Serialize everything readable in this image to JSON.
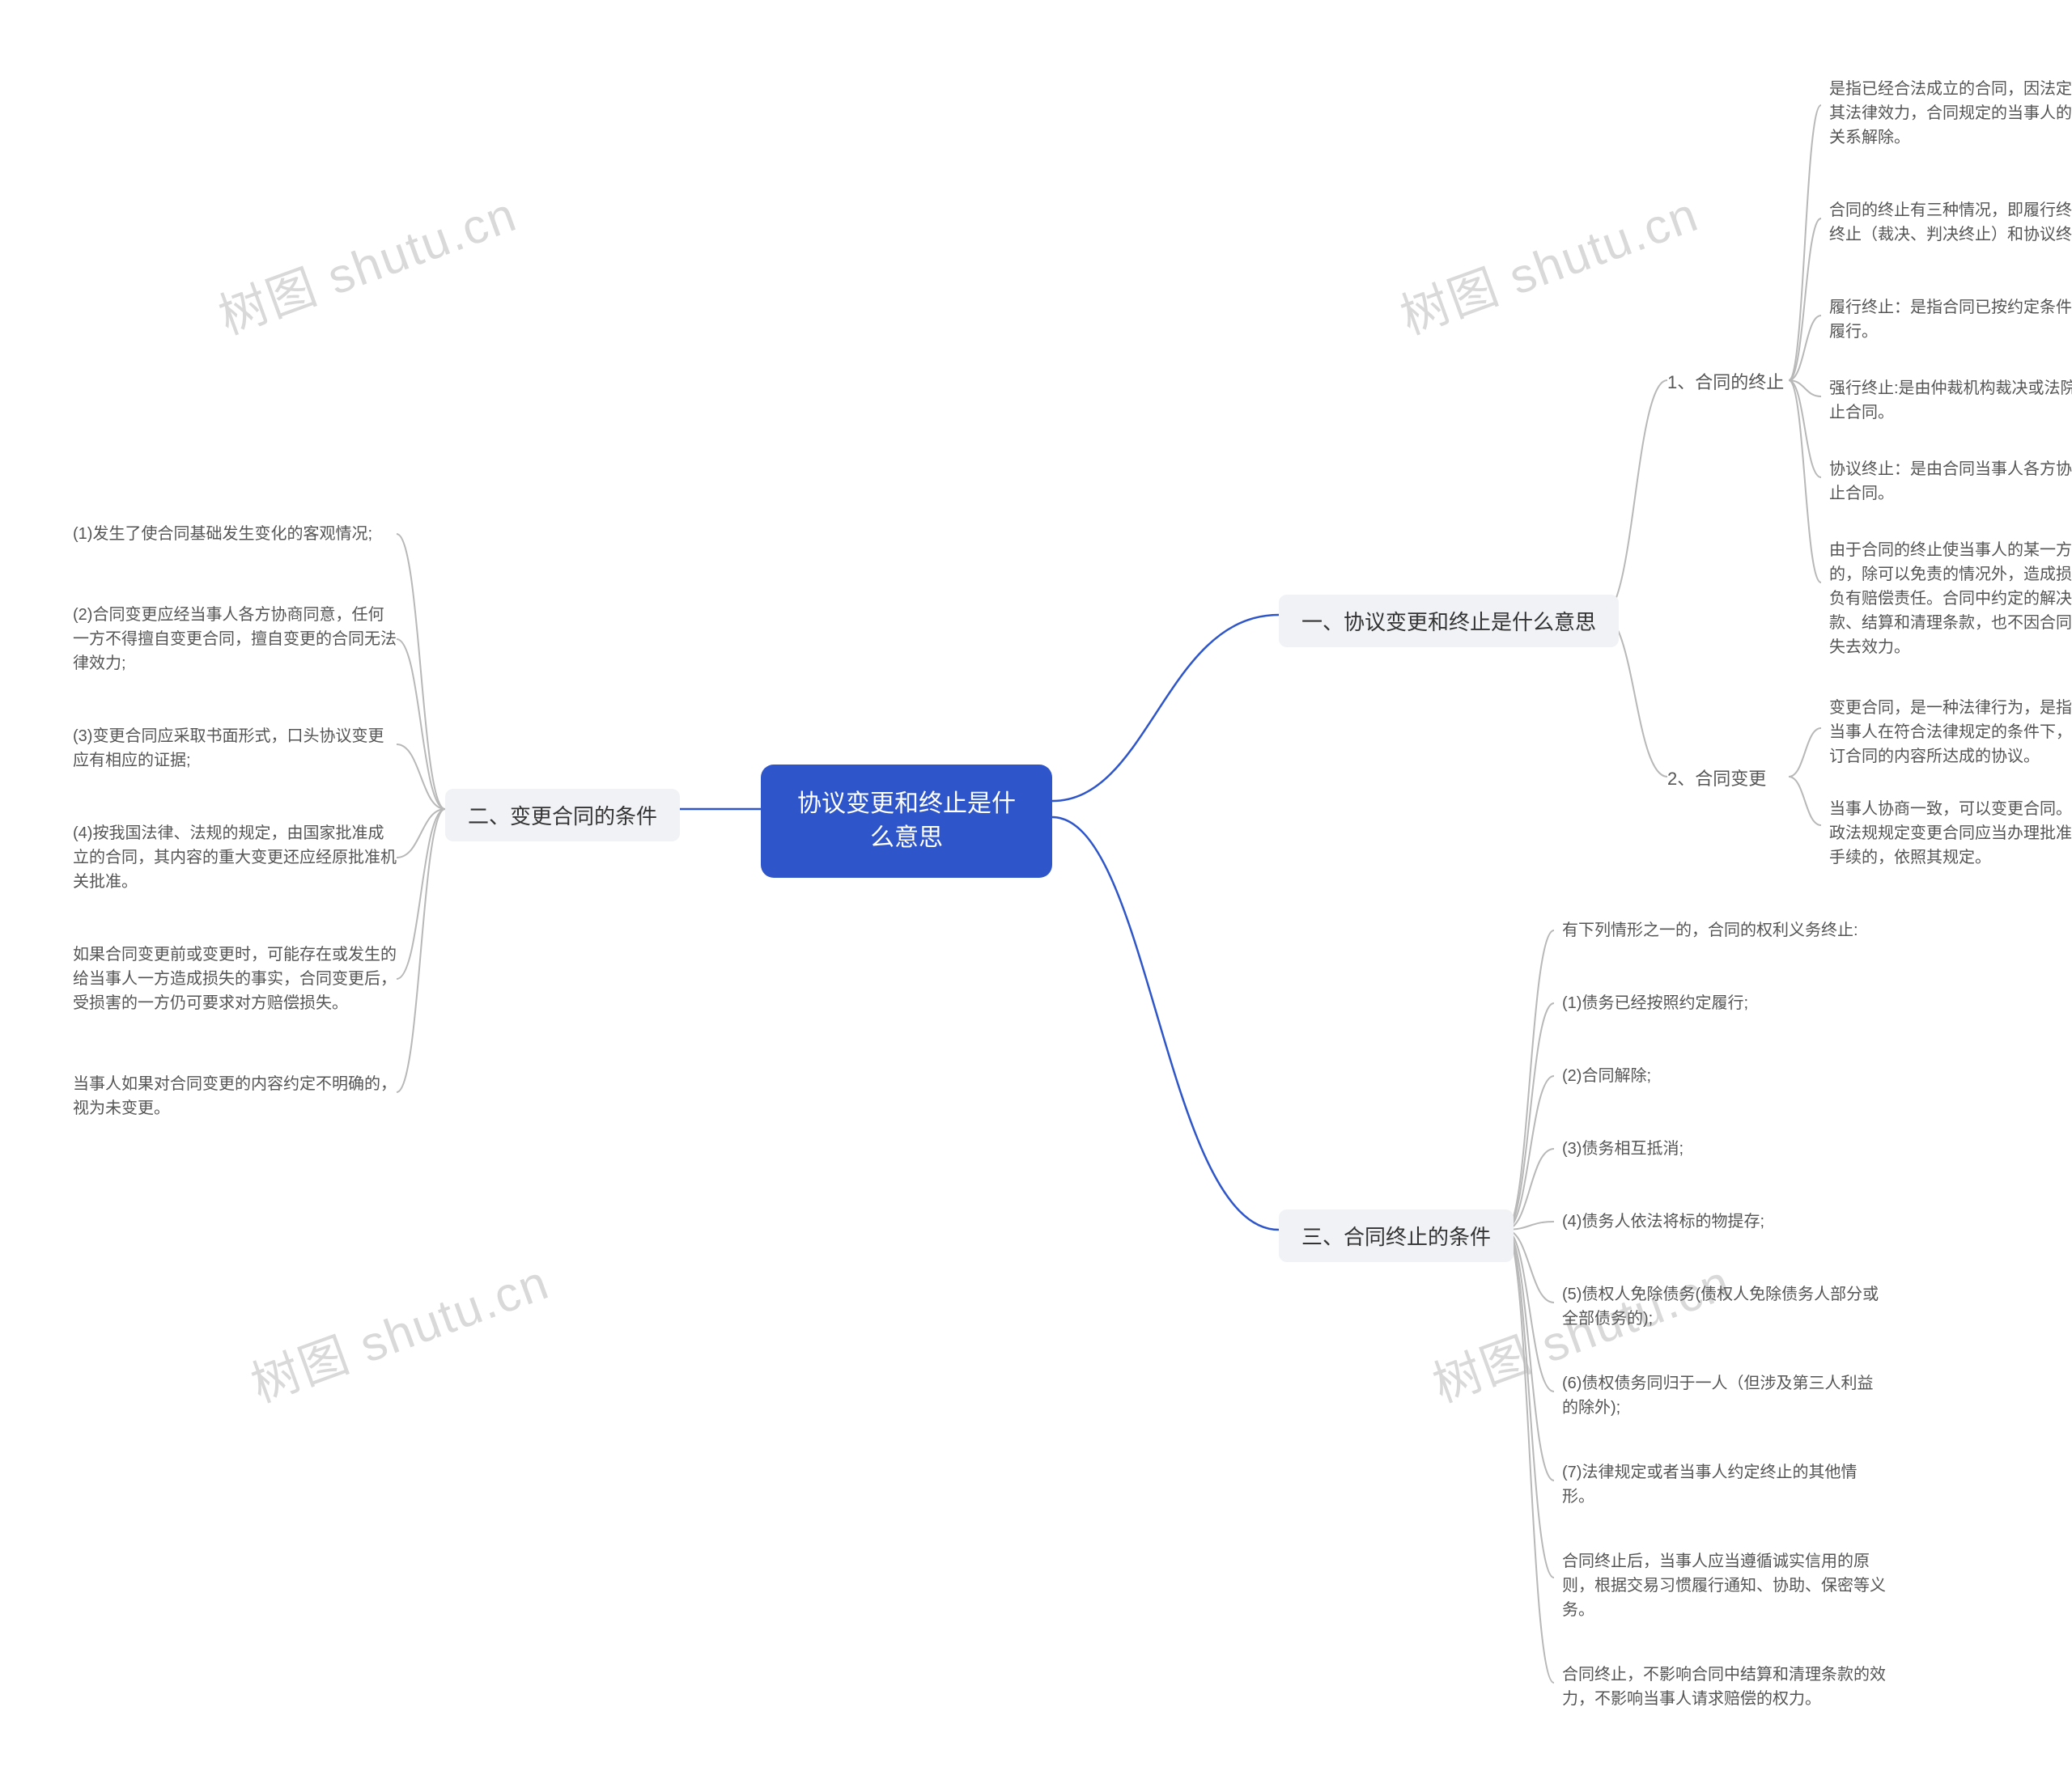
{
  "watermark": "树图 shutu.cn",
  "root": "协议变更和终止是什么意思",
  "b1": {
    "title": "一、协议变更和终止是什么意思",
    "s1": {
      "title": "1、合同的终止",
      "leaves": [
        "是指已经合法成立的合同，因法定原因终止其法律效力，合同规定的当事人的权利义务关系解除。",
        "合同的终止有三种情况，即履行终止、强行终止（裁决、判决终止）和协议终止。",
        "履行终止：是指合同已按约定条件得到全面履行。",
        "强行终止:是由仲裁机构裁决或法院判决终止合同。",
        "协议终止：是由合同当事人各方协商同意终止合同。",
        "由于合同的终止使当事人的某一方遭受损失的，除可以免责的情况外，造成损失的一方负有赔偿责任。合同中约定的解决争议的条款、结算和清理条款，也不因合同的终止而失去效力。"
      ]
    },
    "s2": {
      "title": "2、合同变更",
      "leaves": [
        "变更合同，是一种法律行为，是指签约双方当事人在符合法律规定的条件下，就修改原订合同的内容所达成的协议。",
        "当事人协商一致，可以变更合同。法律、行政法规规定变更合同应当办理批准、登记等手续的，依照其规定。"
      ]
    }
  },
  "b2": {
    "title": "二、变更合同的条件",
    "leaves": [
      "(1)发生了使合同基础发生变化的客观情况;",
      "(2)合同变更应经当事人各方协商同意，任何一方不得擅自变更合同，擅自变更的合同无法律效力;",
      "(3)变更合同应采取书面形式，口头协议变更应有相应的证据;",
      "(4)按我国法律、法规的规定，由国家批准成立的合同，其内容的重大变更还应经原批准机关批准。",
      "如果合同变更前或变更时，可能存在或发生的给当事人一方造成损失的事实，合同变更后，受损害的一方仍可要求对方赔偿损失。",
      "当事人如果对合同变更的内容约定不明确的，视为未变更。"
    ]
  },
  "b3": {
    "title": "三、合同终止的条件",
    "leaves": [
      "有下列情形之一的，合同的权利义务终止:",
      "(1)债务已经按照约定履行;",
      "(2)合同解除;",
      "(3)债务相互抵消;",
      "(4)债务人依法将标的物提存;",
      "(5)债权人免除债务(债权人免除债务人部分或全部债务的);",
      "(6)债权债务同归于一人（但涉及第三人利益的除外);",
      "(7)法律规定或者当事人约定终止的其他情形。",
      "合同终止后，当事人应当遵循诚实信用的原则，根据交易习惯履行通知、协助、保密等义务。",
      "合同终止，不影响合同中结算和清理条款的效力，不影响当事人请求赔偿的权力。"
    ]
  }
}
